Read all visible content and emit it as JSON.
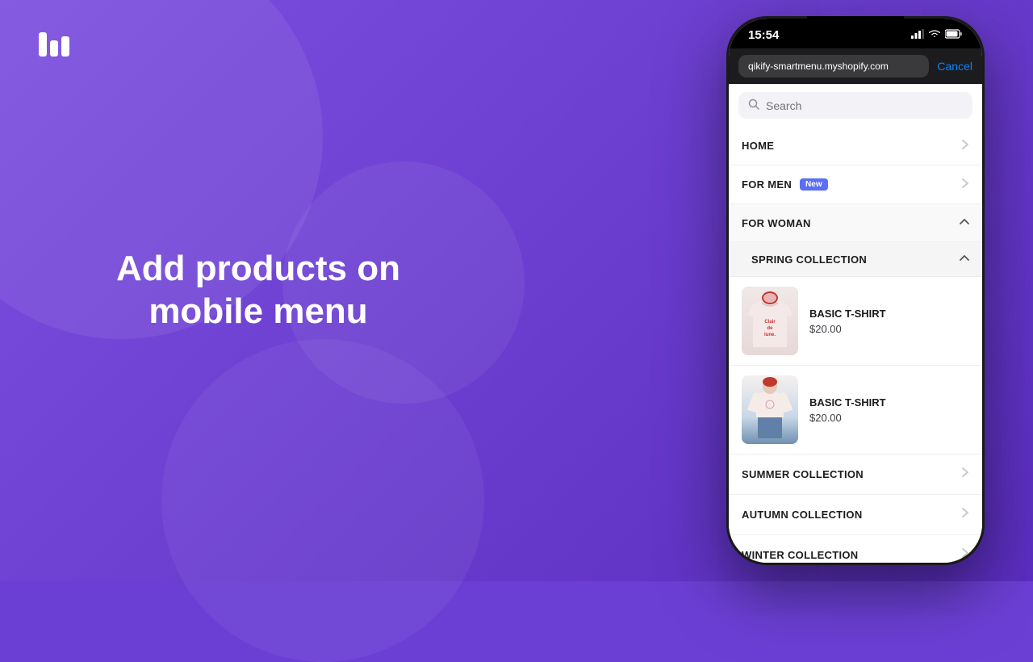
{
  "background": {
    "color": "#6b3fd4"
  },
  "logo": {
    "alt": "Qikify logo"
  },
  "headline": {
    "line1": "Add products on",
    "line2": "mobile menu"
  },
  "phone": {
    "status_bar": {
      "time": "15:54",
      "signal_icon": "📶",
      "wifi_icon": "wifi",
      "battery_icon": "battery"
    },
    "browser": {
      "url": "qikify-smartmenu.myshopify.com",
      "cancel_label": "Cancel"
    },
    "search": {
      "placeholder": "Search"
    },
    "menu_items": [
      {
        "label": "HOME",
        "badge": null,
        "expanded": false
      },
      {
        "label": "FOR MEN",
        "badge": "New",
        "expanded": false
      },
      {
        "label": "FOR WOMAN",
        "badge": null,
        "expanded": true
      }
    ],
    "spring_collection": {
      "label": "SPRING COLLECTION",
      "expanded": true
    },
    "products": [
      {
        "name": "BASIC T-SHIRT",
        "price": "$20.00",
        "image_type": "pink_tshirt"
      },
      {
        "name": "BASIC T-SHIRT",
        "price": "$20.00",
        "image_type": "jeans_tshirt"
      }
    ],
    "sub_collections": [
      {
        "label": "SUMMER COLLECTION"
      },
      {
        "label": "AUTUMN COLLECTION"
      },
      {
        "label": "WINTER COLLECTION"
      }
    ],
    "chevron_down": "⌄",
    "chevron_up": "⌃"
  }
}
